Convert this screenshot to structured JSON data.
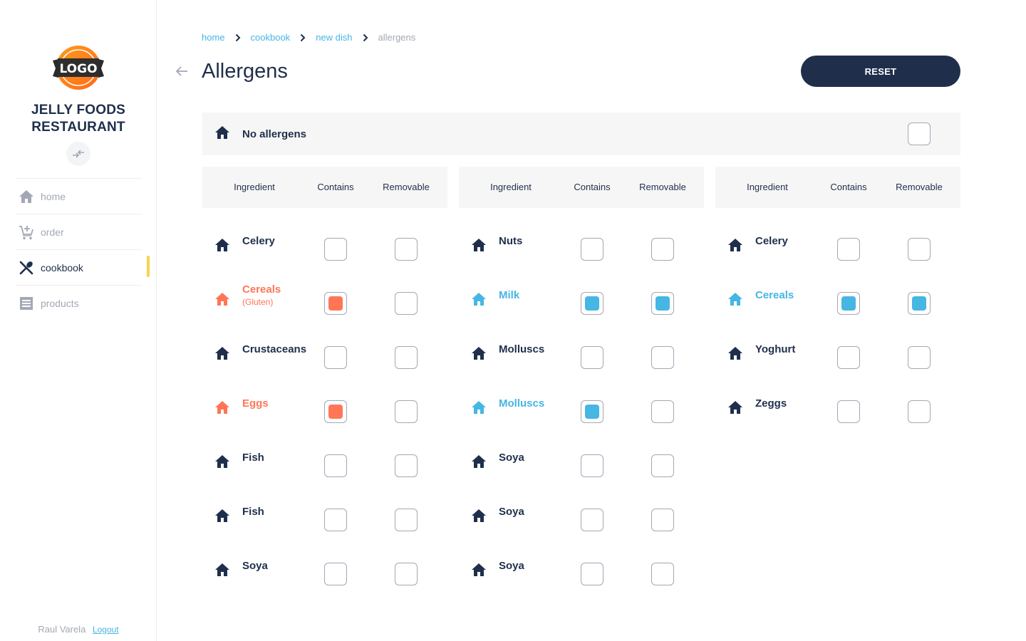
{
  "sidebar": {
    "logo_text": "LOGO",
    "brand_line1": "JELLY FOODS",
    "brand_line2": "RESTAURANT",
    "collapse_icon": "arrows-collapse-icon",
    "nav": [
      {
        "label": "home",
        "icon": "home-icon",
        "active": false
      },
      {
        "label": "order",
        "icon": "cart-add-icon",
        "active": false
      },
      {
        "label": "cookbook",
        "icon": "cutlery-icon",
        "active": true
      },
      {
        "label": "products",
        "icon": "list-icon",
        "active": false
      }
    ],
    "user_name": "Raul Varela",
    "logout_label": "Logout"
  },
  "breadcrumb": [
    {
      "label": "home"
    },
    {
      "label": "cookbook"
    },
    {
      "label": "new dish"
    },
    {
      "label": "allergens",
      "current": true
    }
  ],
  "page": {
    "title": "Allergens",
    "reset_label": "RESET"
  },
  "no_allergens": {
    "label": "No allergens",
    "checked": false
  },
  "colors": {
    "navy": "#1f2f4b",
    "orange": "#ff7657",
    "blue": "#46b6e3",
    "accent_yellow": "#f7d44c",
    "muted": "#a3a8b4"
  },
  "table_headers": {
    "ingredient": "Ingredient",
    "contains": "Contains",
    "removable": "Removable"
  },
  "columns": [
    {
      "rows": [
        {
          "name": "Celery",
          "contains": false,
          "removable": false,
          "tone": ""
        },
        {
          "name": "Cereals",
          "sub": "(Gluten)",
          "contains": true,
          "removable": false,
          "tone": "orange"
        },
        {
          "name": "Crustaceans",
          "contains": false,
          "removable": false,
          "tone": ""
        },
        {
          "name": "Eggs",
          "contains": true,
          "removable": false,
          "tone": "orange"
        },
        {
          "name": "Fish",
          "contains": false,
          "removable": false,
          "tone": ""
        },
        {
          "name": "Fish",
          "contains": false,
          "removable": false,
          "tone": ""
        },
        {
          "name": "Soya",
          "contains": false,
          "removable": false,
          "tone": ""
        }
      ]
    },
    {
      "rows": [
        {
          "name": "Nuts",
          "contains": false,
          "removable": false,
          "tone": ""
        },
        {
          "name": "Milk",
          "contains": true,
          "removable": true,
          "tone": "blue"
        },
        {
          "name": "Molluscs",
          "contains": false,
          "removable": false,
          "tone": ""
        },
        {
          "name": "Molluscs",
          "contains": true,
          "removable": false,
          "tone": "blue"
        },
        {
          "name": "Soya",
          "contains": false,
          "removable": false,
          "tone": ""
        },
        {
          "name": "Soya",
          "contains": false,
          "removable": false,
          "tone": ""
        },
        {
          "name": "Soya",
          "contains": false,
          "removable": false,
          "tone": ""
        }
      ]
    },
    {
      "rows": [
        {
          "name": "Celery",
          "contains": false,
          "removable": false,
          "tone": ""
        },
        {
          "name": "Cereals",
          "contains": true,
          "removable": true,
          "tone": "blue"
        },
        {
          "name": "Yoghurt",
          "contains": false,
          "removable": false,
          "tone": ""
        },
        {
          "name": "Zeggs",
          "contains": false,
          "removable": false,
          "tone": ""
        }
      ]
    }
  ]
}
